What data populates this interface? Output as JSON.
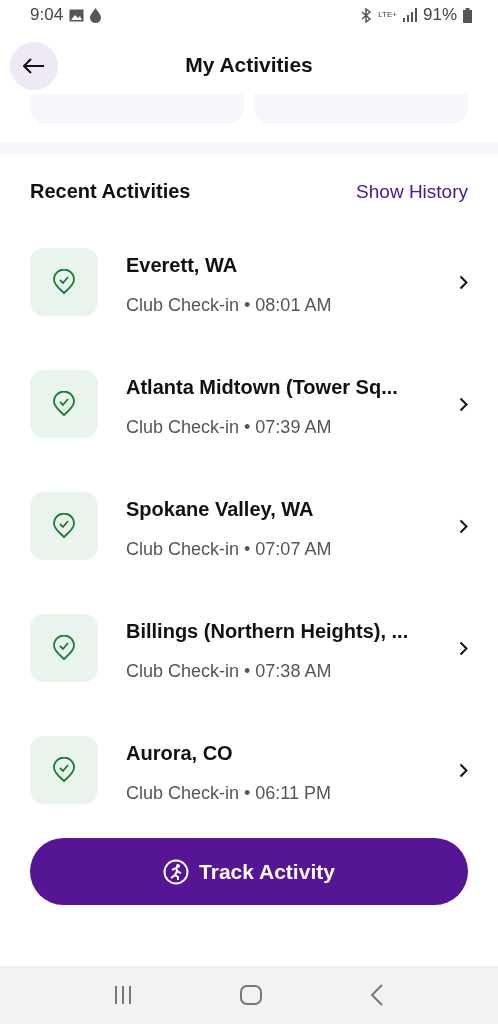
{
  "status_bar": {
    "time": "9:04",
    "network": "LTE+",
    "battery": "91%"
  },
  "header": {
    "title": "My Activities"
  },
  "stat_cards": [
    {
      "kind": "card"
    },
    {
      "kind": "card"
    }
  ],
  "recent": {
    "title": "Recent Activities",
    "link": "Show History"
  },
  "activities": [
    {
      "name": "Everett, WA",
      "detail": "Club Check-in • 08:01 AM"
    },
    {
      "name": "Atlanta Midtown (Tower Sq...",
      "detail": "Club Check-in • 07:39 AM"
    },
    {
      "name": "Spokane Valley, WA",
      "detail": "Club Check-in • 07:07 AM"
    },
    {
      "name": "Billings (Northern Heights), ...",
      "detail": "Club Check-in • 07:38 AM"
    },
    {
      "name": "Aurora, CO",
      "detail": "Club Check-in • 06:11 PM"
    }
  ],
  "primary_button": {
    "label": "Track Activity"
  }
}
